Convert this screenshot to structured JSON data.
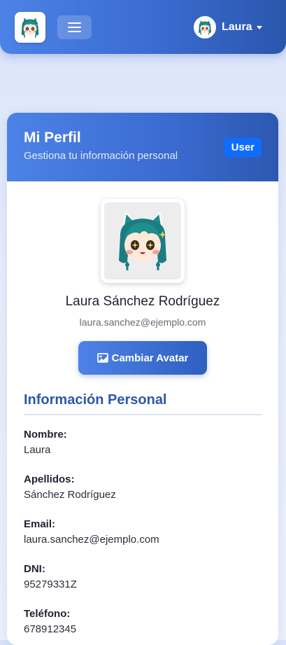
{
  "navbar": {
    "user_name": "Laura"
  },
  "header": {
    "title": "Mi Perfil",
    "subtitle": "Gestiona tu información personal",
    "role_badge": "User"
  },
  "profile": {
    "full_name": "Laura Sánchez Rodríguez",
    "email": "laura.sanchez@ejemplo.com",
    "change_avatar_label": "Cambiar Avatar"
  },
  "personal_info": {
    "title": "Información Personal",
    "fields": [
      {
        "label": "Nombre:",
        "value": "Laura"
      },
      {
        "label": "Apellidos:",
        "value": "Sánchez Rodríguez"
      },
      {
        "label": "Email:",
        "value": "laura.sanchez@ejemplo.com"
      },
      {
        "label": "DNI:",
        "value": "95279331Z"
      },
      {
        "label": "Teléfono:",
        "value": "678912345"
      }
    ]
  },
  "colors": {
    "brand_blue": "#3a6bd0",
    "badge_blue": "#0d6efd",
    "section_title": "#2c58a8"
  },
  "icons": [
    "menu-icon",
    "caret-down-icon",
    "image-icon",
    "avatar-illustration"
  ]
}
